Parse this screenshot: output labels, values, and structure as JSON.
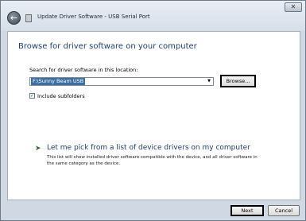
{
  "window": {
    "title": "Update Driver Software - USB Serial Port",
    "close_glyph": "✕"
  },
  "page": {
    "heading": "Browse for driver software on your computer",
    "search_label": "Search for driver software in this location:",
    "path_value": "F:\\Sunny Beam USB",
    "browse_label": "Browse...",
    "include_subfolders_label": "Include subfolders",
    "include_subfolders_checked": true
  },
  "pick_option": {
    "title": "Let me pick from a list of device drivers on my computer",
    "description": "This list will show installed driver software compatible with the device, and all driver software in the same category as the device."
  },
  "footer": {
    "next_label": "Next",
    "cancel_label": "Cancel"
  },
  "icons": {
    "back": "back-arrow-icon",
    "driver": "driver-device-icon",
    "option_arrow": "green-arrow-icon"
  }
}
